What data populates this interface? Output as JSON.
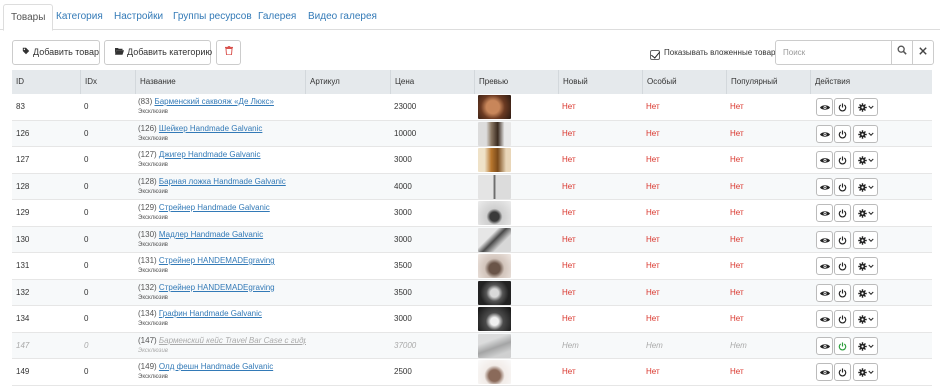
{
  "tabs": [
    {
      "label": "Товары",
      "active": true
    },
    {
      "label": "Категория"
    },
    {
      "label": "Настройки"
    },
    {
      "label": "Группы ресурсов"
    },
    {
      "label": "Галерея"
    },
    {
      "label": "Видео галерея"
    }
  ],
  "toolbar": {
    "add_product_label": "Добавить товар",
    "add_category_label": "Добавить категорию",
    "show_nested_label": "Показывать вложенные товары",
    "show_nested_checked": true,
    "search_placeholder": "Поиск"
  },
  "columns": [
    "ID",
    "IDx",
    "Название",
    "Артикул",
    "Цена",
    "Превью",
    "Новый",
    "Особый",
    "Популярный",
    "Действия"
  ],
  "rows": [
    {
      "id": "83",
      "idx": "0",
      "name_prefix": "(83)",
      "name": "Барменский саквояж «Де Люкс»",
      "category": "Эксклюзив",
      "article": "",
      "price": "23000",
      "preview": "leather-bag",
      "new": "Нет",
      "special": "Нет",
      "popular": "Нет",
      "active": true
    },
    {
      "id": "126",
      "idx": "0",
      "name_prefix": "(126)",
      "name": "Шейкер Handmade Galvanic",
      "category": "Эксклюзив",
      "article": "",
      "price": "10000",
      "preview": "shaker",
      "new": "Нет",
      "special": "Нет",
      "popular": "Нет",
      "active": true
    },
    {
      "id": "127",
      "idx": "0",
      "name_prefix": "(127)",
      "name": "Джигер Handmade Galvanic",
      "category": "Эксклюзив",
      "article": "",
      "price": "3000",
      "preview": "jigger",
      "new": "Нет",
      "special": "Нет",
      "popular": "Нет",
      "active": true
    },
    {
      "id": "128",
      "idx": "0",
      "name_prefix": "(128)",
      "name": "Барная ложка Handmade Galvanic",
      "category": "Эксклюзив",
      "article": "",
      "price": "4000",
      "preview": "bar-spoon",
      "new": "Нет",
      "special": "Нет",
      "popular": "Нет",
      "active": true
    },
    {
      "id": "129",
      "idx": "0",
      "name_prefix": "(129)",
      "name": "Стрейнер Handmade Galvanic",
      "category": "Эксклюзив",
      "article": "",
      "price": "3000",
      "preview": "strainer",
      "new": "Нет",
      "special": "Нет",
      "popular": "Нет",
      "active": true
    },
    {
      "id": "130",
      "idx": "0",
      "name_prefix": "(130)",
      "name": "Мадлер Handmade Galvanic",
      "category": "Эксклюзив",
      "article": "",
      "price": "3000",
      "preview": "muddler",
      "new": "Нет",
      "special": "Нет",
      "popular": "Нет",
      "active": true
    },
    {
      "id": "131",
      "idx": "0",
      "name_prefix": "(131)",
      "name": "Стрейнер HANDEMADEgraving",
      "category": "Эксклюзив",
      "article": "",
      "price": "3500",
      "preview": "engraved-strainer",
      "new": "Нет",
      "special": "Нет",
      "popular": "Нет",
      "active": true
    },
    {
      "id": "132",
      "idx": "0",
      "name_prefix": "(132)",
      "name": "Стрейнер HANDEMADEgraving",
      "category": "Эксклюзив",
      "article": "",
      "price": "3500",
      "preview": "engraved-strainer-2",
      "new": "Нет",
      "special": "Нет",
      "popular": "Нет",
      "active": true
    },
    {
      "id": "134",
      "idx": "0",
      "name_prefix": "(134)",
      "name": "Графин Handmade Galvanic",
      "category": "Эксклюзив",
      "article": "",
      "price": "3000",
      "preview": "decanter",
      "new": "Нет",
      "special": "Нет",
      "popular": "Нет",
      "active": true
    },
    {
      "id": "147",
      "idx": "0",
      "name_prefix": "(147)",
      "name": "Барменский кейс Travel Bar Case с гидрав",
      "category": "Эксклюзив",
      "article": "",
      "price": "37000",
      "preview": "bar-case",
      "new": "Нет",
      "special": "Нет",
      "popular": "Нет",
      "active": false
    },
    {
      "id": "149",
      "idx": "0",
      "name_prefix": "(149)",
      "name": "Олд фешн Handmade Galvanic",
      "category": "Эксклюзив",
      "article": "",
      "price": "2500",
      "preview": "old-fashioned-glass",
      "new": "Нет",
      "special": "Нет",
      "popular": "Нет",
      "active": true
    }
  ],
  "colors": {
    "link": "#337ab7",
    "no_value": "#d9342b",
    "header_bg": "#e5e9ec",
    "delete_icon": "#d9534f",
    "power_active": "#2a9d3a"
  }
}
